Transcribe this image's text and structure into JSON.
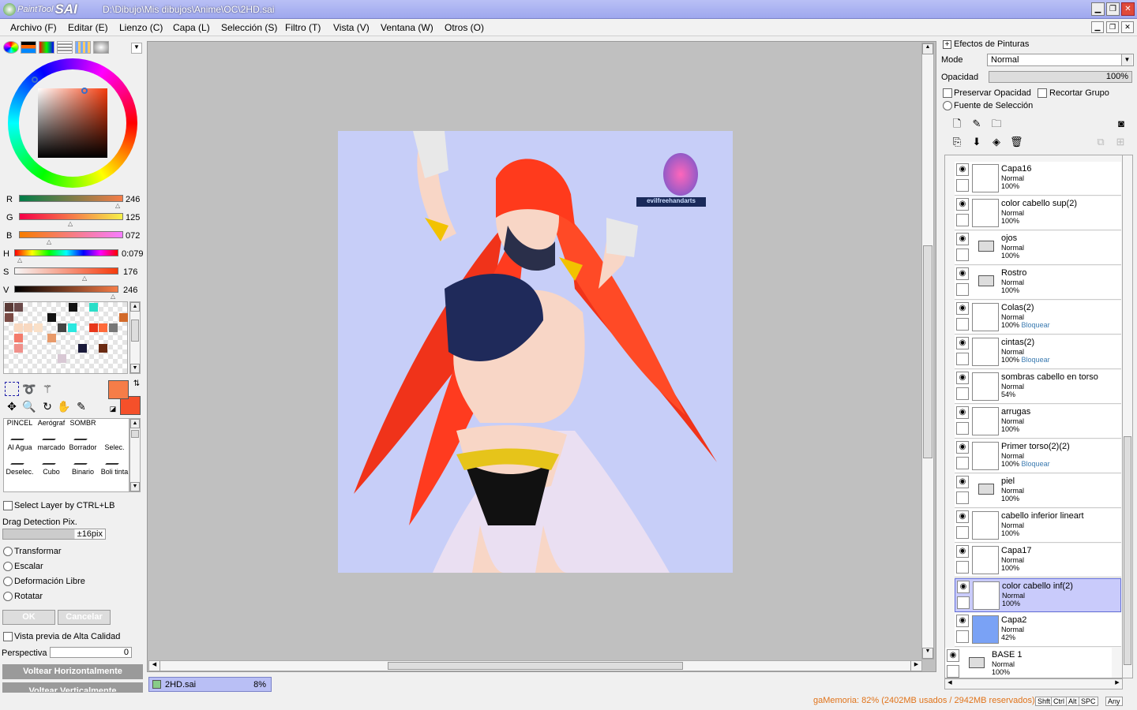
{
  "app": {
    "logo_small": "PaintTool",
    "logo_big": "SAI",
    "title": "D:\\Dibujo\\Mis dibujos\\Anime\\OC\\2HD.sai"
  },
  "menu": [
    "Archivo (F)",
    "Editar (E)",
    "Lienzo (C)",
    "Capa (L)",
    "Selección (S)",
    "Filtro (T)",
    "Vista (V)",
    "Ventana (W)",
    "Otros (O)"
  ],
  "color": {
    "r": {
      "label": "R",
      "value": "246"
    },
    "g": {
      "label": "G",
      "value": "125"
    },
    "b": {
      "label": "B",
      "value": "072"
    },
    "h": {
      "label": "H",
      "value": "0:079"
    },
    "s": {
      "label": "S",
      "value": "176"
    },
    "v": {
      "label": "V",
      "value": "246"
    },
    "primary": "#f67d48",
    "secondary": "#f5502a"
  },
  "brushes": [
    "PINCEL",
    "Aerógraf",
    "SOMBR",
    "Al Agua",
    "marcado",
    "Borrador",
    "Selec.",
    "Deselec.",
    "Cubo",
    "Binario",
    "Boli tinta"
  ],
  "tool_options": {
    "select_layer": "Select Layer by CTRL+LB",
    "drag_detection": "Drag Detection Pix.",
    "drag_value": "±16pix",
    "transform": "Transformar",
    "scale": "Escalar",
    "free_deform": "Deformación Libre",
    "rotate": "Rotatar",
    "ok": "OK",
    "cancel": "Cancelar",
    "hq_preview": "Vista previa de Alta Calidad",
    "perspective": "Perspectiva",
    "perspective_value": "0",
    "flip_h": "Voltear Horizontalmente",
    "flip_v": "Voltear Verticalmente"
  },
  "document_tab": {
    "name": "2HD.sai",
    "zoom": "8%"
  },
  "canvas": {
    "background": "#c7cef8",
    "watermark": "evilfreehandarts"
  },
  "status": {
    "memory": "gaMemoria: 82% (2402MB usados / 2942MB reservados)",
    "keys": [
      "Shft",
      "Ctrl",
      "Alt",
      "SPC",
      "Any"
    ]
  },
  "effects": {
    "title": "Efectos de Pinturas",
    "mode_label": "Mode",
    "mode_value": "Normal",
    "opacity_label": "Opacidad",
    "opacity_value": "100%",
    "preserve_opacity": "Preservar Opacidad",
    "clip_group": "Recortar Grupo",
    "selection_source": "Fuente de Selección"
  },
  "layers": [
    {
      "name": "Capa16",
      "mode": "Normal",
      "opacity": "100%",
      "lock": "",
      "folder": false,
      "selected": false,
      "thumb": "#fff"
    },
    {
      "name": "color cabello sup(2)",
      "mode": "Normal",
      "opacity": "100%",
      "lock": "",
      "folder": false,
      "selected": false,
      "thumb": "#fff"
    },
    {
      "name": "ojos",
      "mode": "Normal",
      "opacity": "100%",
      "lock": "",
      "folder": true,
      "selected": false,
      "thumb": "#fff"
    },
    {
      "name": "Rostro",
      "mode": "Normal",
      "opacity": "100%",
      "lock": "",
      "folder": true,
      "selected": false,
      "thumb": "#fff"
    },
    {
      "name": "Colas(2)",
      "mode": "Normal",
      "opacity": "100%",
      "lock": "Bloquear",
      "folder": false,
      "selected": false,
      "thumb": "#fff"
    },
    {
      "name": "cintas(2)",
      "mode": "Normal",
      "opacity": "100%",
      "lock": "Bloquear",
      "folder": false,
      "selected": false,
      "thumb": "#fff"
    },
    {
      "name": "sombras cabello en torso",
      "mode": "Normal",
      "opacity": "54%",
      "lock": "",
      "folder": false,
      "selected": false,
      "thumb": "#fff"
    },
    {
      "name": "arrugas",
      "mode": "Normal",
      "opacity": "100%",
      "lock": "",
      "folder": false,
      "selected": false,
      "thumb": "#fff"
    },
    {
      "name": "Primer torso(2)(2)",
      "mode": "Normal",
      "opacity": "100%",
      "lock": "Bloquear",
      "folder": false,
      "selected": false,
      "thumb": "#fff"
    },
    {
      "name": "piel",
      "mode": "Normal",
      "opacity": "100%",
      "lock": "",
      "folder": true,
      "selected": false,
      "thumb": "#fff"
    },
    {
      "name": "cabello inferior lineart",
      "mode": "Normal",
      "opacity": "100%",
      "lock": "",
      "folder": false,
      "selected": false,
      "thumb": "#fff"
    },
    {
      "name": "Capa17",
      "mode": "Normal",
      "opacity": "100%",
      "lock": "",
      "folder": false,
      "selected": false,
      "thumb": "#fff"
    },
    {
      "name": "color cabello inf(2)",
      "mode": "Normal",
      "opacity": "100%",
      "lock": "",
      "folder": false,
      "selected": true,
      "thumb": "#fff"
    },
    {
      "name": "Capa2",
      "mode": "Normal",
      "opacity": "42%",
      "lock": "",
      "folder": false,
      "selected": false,
      "thumb": "#7aa2f5"
    },
    {
      "name": "BASE 1",
      "mode": "Normal",
      "opacity": "100%",
      "lock": "",
      "folder": true,
      "selected": false,
      "thumb": "#fff"
    }
  ]
}
